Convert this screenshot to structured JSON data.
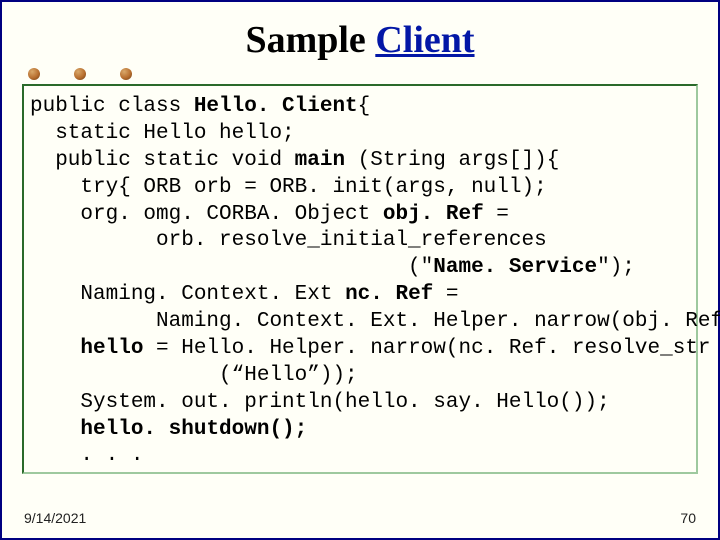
{
  "title": {
    "part1": "Sample ",
    "part2": "Client"
  },
  "footer": {
    "date": "9/14/2021",
    "page": "70"
  },
  "code": {
    "l1a": "public class ",
    "l1b": "Hello. Client",
    "l1c": "{",
    "l2": "  static Hello hello;",
    "l3a": "  public static void ",
    "l3b": "main",
    "l3c": " (String args[]){",
    "l4": "    try{ ORB orb = ORB. init(args, null);",
    "l5a": "    org. omg. CORBA. Object ",
    "l5b": "obj. Ref",
    "l5c": " =",
    "l6": "          orb. resolve_initial_references",
    "l7a": "                              (\"",
    "l7b": "Name. Service",
    "l7c": "\");",
    "l8a": "    Naming. Context. Ext ",
    "l8b": "nc. Ref",
    "l8c": " = ",
    "l9": "          Naming. Context. Ext. Helper. narrow(obj. Ref);",
    "l10a": "    ",
    "l10b": "hello",
    "l10c": " = Hello. Helper. narrow(nc. Ref. resolve_str",
    "l11": "               (“Hello”));",
    "l12": "    System. out. println(hello. say. Hello());",
    "l13a": "    ",
    "l13b": "hello. shutdown();",
    "l14": "    . . ."
  }
}
